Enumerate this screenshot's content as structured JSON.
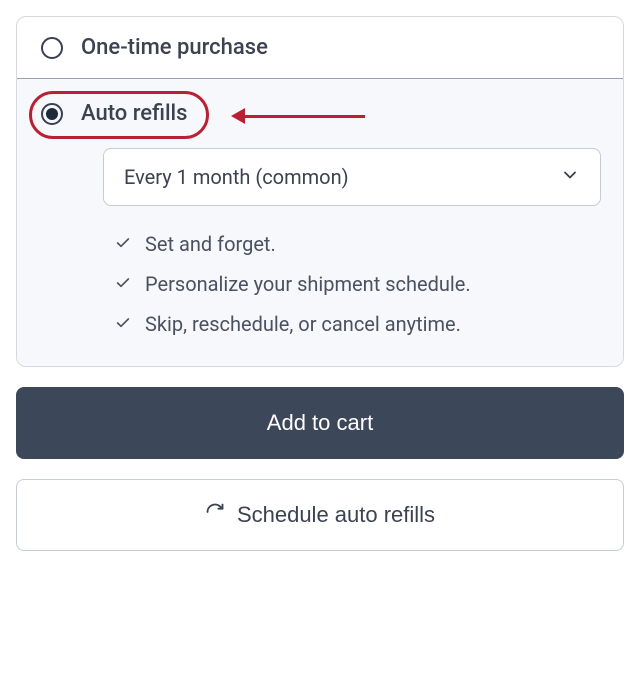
{
  "options": {
    "onetime": {
      "label": "One-time purchase",
      "selected": false
    },
    "auto": {
      "label": "Auto refills",
      "selected": true,
      "frequency": "Every 1 month (common)",
      "benefits": [
        "Set and forget.",
        "Personalize your shipment schedule.",
        "Skip, reschedule, or cancel anytime."
      ]
    }
  },
  "buttons": {
    "add_to_cart": "Add to cart",
    "schedule": "Schedule auto refills"
  }
}
